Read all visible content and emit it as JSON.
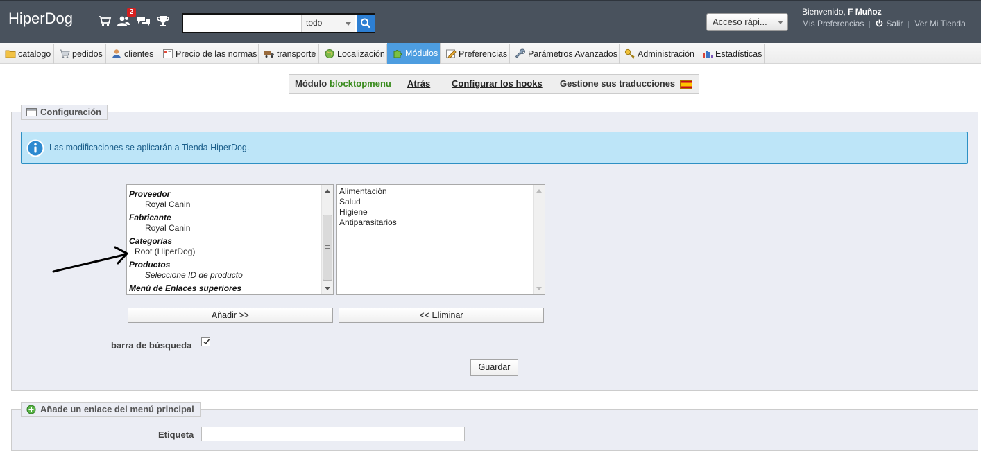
{
  "header": {
    "shop_name": "HiperDog",
    "notification_count": "2",
    "search": {
      "value": "",
      "scope": "todo"
    },
    "quick_access": "Acceso rápi...",
    "welcome_prefix": "Bienvenido, ",
    "user_name": "F Muñoz",
    "links": {
      "preferences": "Mis Preferencias",
      "logout": "Salir",
      "view_shop": "Ver Mi Tienda"
    }
  },
  "tabs": [
    {
      "label": "catalogo",
      "icon": "folder-icon"
    },
    {
      "label": "pedidos",
      "icon": "cart-icon"
    },
    {
      "label": "clientes",
      "icon": "user-icon"
    },
    {
      "label": "Precio de las normas",
      "icon": "price-rules-icon"
    },
    {
      "label": "transporte",
      "icon": "truck-icon"
    },
    {
      "label": "Localización",
      "icon": "globe-icon"
    },
    {
      "label": "Módulos",
      "icon": "puzzle-icon",
      "active": true
    },
    {
      "label": "Preferencias",
      "icon": "preferences-icon"
    },
    {
      "label": "Parámetros Avanzados",
      "icon": "wrench-icon"
    },
    {
      "label": "Administración",
      "icon": "key-icon"
    },
    {
      "label": "Estadísticas",
      "icon": "stats-icon"
    }
  ],
  "module_bar": {
    "prefix": "Módulo",
    "module_name": "blocktopmenu",
    "back": "Atrás",
    "hooks": "Configurar los hooks",
    "translations": "Gestione sus traducciones"
  },
  "config": {
    "legend": "Configuración",
    "info": "Las modificaciones se aplicarán a Tienda HiperDog.",
    "available_items": [
      {
        "text": "Proveedor",
        "group": true
      },
      {
        "text": "Royal Canin",
        "group": false
      },
      {
        "text": "Fabricante",
        "group": true
      },
      {
        "text": "Royal Canin",
        "group": false
      },
      {
        "text": "Categorías",
        "group": true
      },
      {
        "text": "Root (HiperDog)",
        "group": false
      },
      {
        "text": "Productos",
        "group": true
      },
      {
        "text": "Seleccione ID de producto",
        "group": false,
        "italic": true
      },
      {
        "text": "Menú de Enlaces superiores",
        "group": true
      }
    ],
    "selected_items": [
      "Alimentación",
      "Salud",
      "Higiene",
      "Antiparasitarios"
    ],
    "add_button": "Añadir >>",
    "remove_button": "<< Eliminar",
    "search_bar_label": "barra de búsqueda",
    "search_bar_checked": true,
    "save_button": "Guardar"
  },
  "add_link": {
    "legend": "Añade un enlace del menú principal",
    "label_field": "Etiqueta",
    "label_value": ""
  },
  "colors": {
    "header_bg": "#49525d",
    "active_tab": "#4d9de0",
    "info_bg": "#bde5f8",
    "module_name": "#3a8c1e",
    "fieldset_bg": "#ebedf4"
  }
}
